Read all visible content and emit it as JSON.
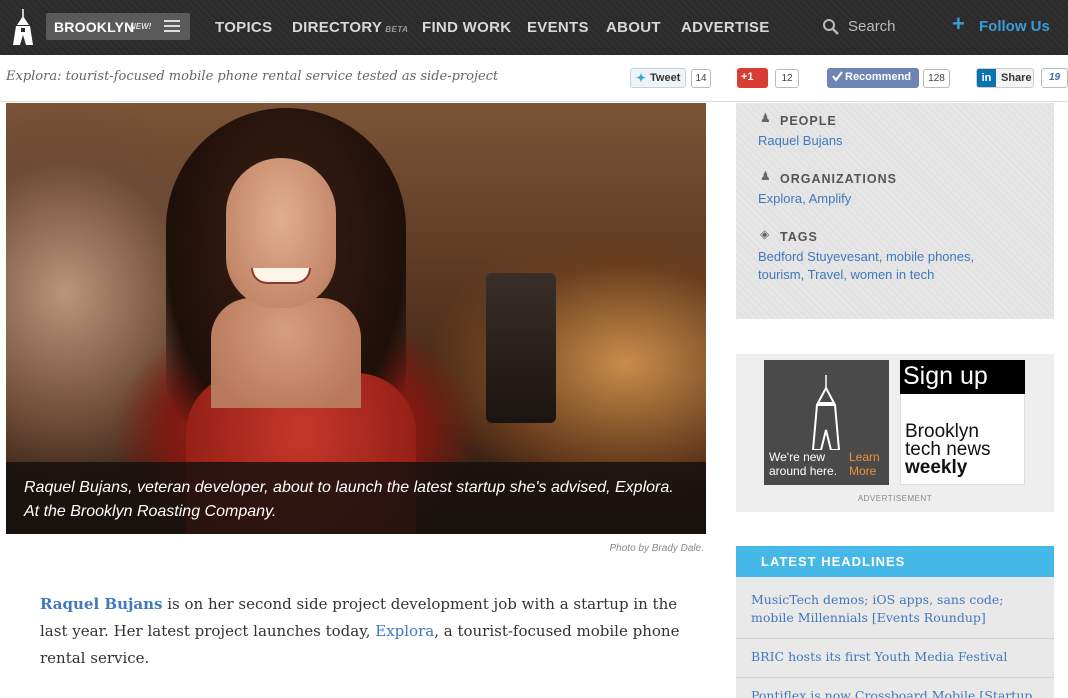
{
  "nav": {
    "city": "BROOKLYN",
    "city_badge": "NEW!",
    "links": [
      "TOPICS",
      "DIRECTORY",
      "FIND WORK",
      "EVENTS",
      "ABOUT",
      "ADVERTISE"
    ],
    "directory_badge": "BETA",
    "search_label": "Search",
    "follow_label": "Follow Us"
  },
  "sharebar": {
    "article_title": "Explora: tourist-focused mobile phone rental service tested as side-project",
    "tweet_label": "Tweet",
    "tweet_count": "14",
    "gplus_label": "+1",
    "gplus_count": "12",
    "recommend_label": "Recommend",
    "recommend_count": "128",
    "linkedin_label": "Share",
    "linkedin_count": "19"
  },
  "hero": {
    "caption": "Raquel Bujans, veteran developer, about to launch the latest startup she's advised, Explora. At the Brooklyn Roasting Company.",
    "credit": "Photo by Brady Dale."
  },
  "article": {
    "person_link": "Raquel Bujans",
    "text_1": " is on her second side project development job with a startup in the last year. Her latest project launches today, ",
    "explora_link": "Explora",
    "text_2": ", a tourist-focused mobile phone rental service."
  },
  "meta": {
    "people_head": "PEOPLE",
    "people": "Raquel Bujans",
    "orgs_head": "ORGANIZATIONS",
    "orgs": [
      "Explora",
      "Amplify"
    ],
    "tags_head": "TAGS",
    "tags": [
      "Bedford Stuyevesant",
      "mobile phones",
      "tourism",
      "Travel",
      "women in tech"
    ]
  },
  "ad": {
    "were_new": "We're new around here.",
    "learn_more": "Learn More",
    "signup": "Sign up",
    "brooklyn": "Brooklyn",
    "tech_news": "tech news",
    "weekly": "weekly",
    "label": "ADVERTISEMENT"
  },
  "headlines": {
    "title": "LATEST HEADLINES",
    "items": [
      "MusicTech demos; iOS apps, sans code; mobile Millennials [Events Roundup]",
      "BRIC hosts its first Youth Media Festival",
      "Pontiflex is now Crossboard Mobile [Startup"
    ]
  },
  "colors": {
    "nav_bg": "#2b2b2b",
    "link_blue": "#4178be",
    "accent_cyan": "#46b8e8",
    "follow_blue": "#3a9bd9",
    "ad_orange": "#f29137"
  }
}
